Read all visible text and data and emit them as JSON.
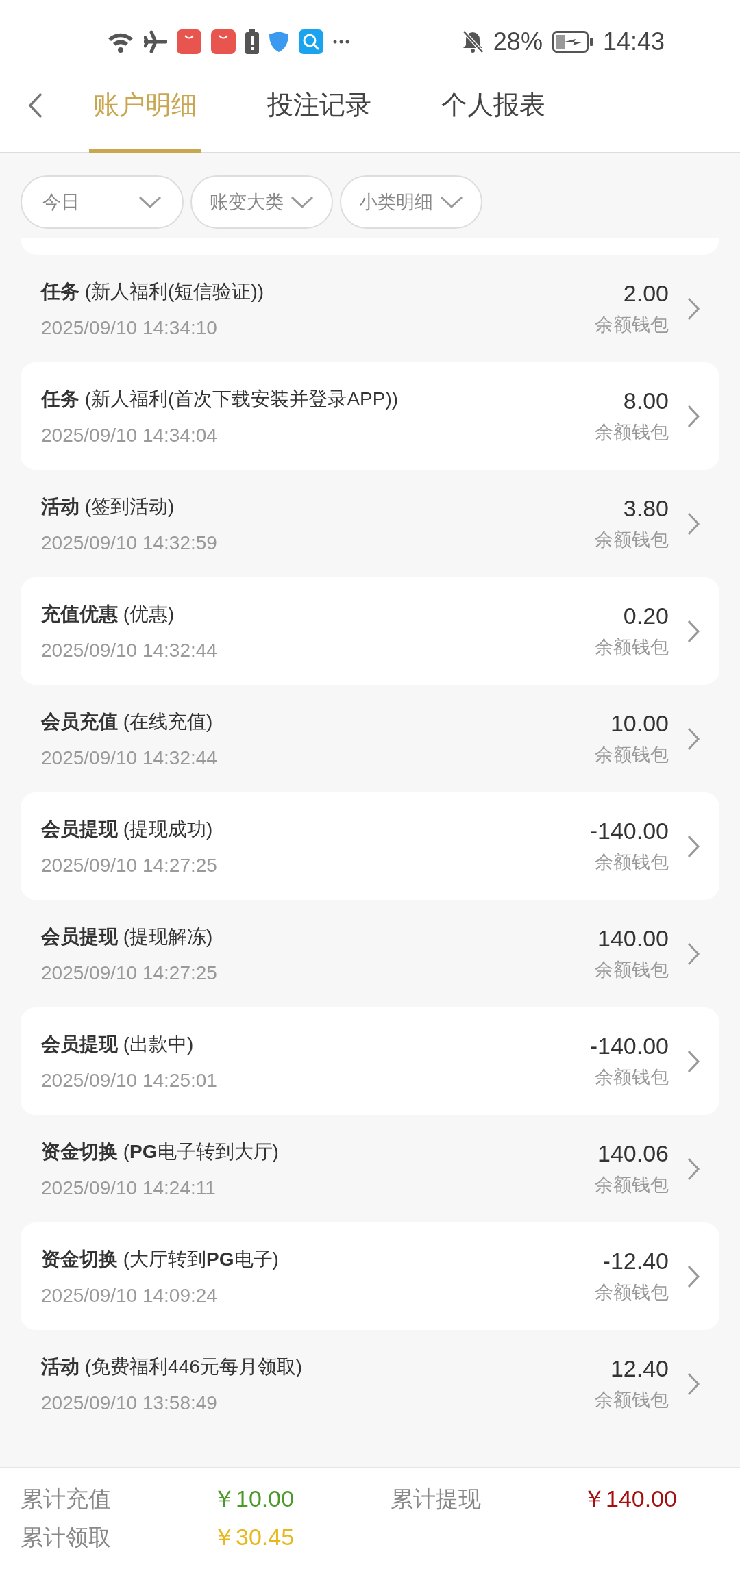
{
  "status_bar": {
    "battery": "28%",
    "time": "14:43"
  },
  "tabs": [
    {
      "label": "账户明细",
      "selected": true
    },
    {
      "label": "投注记录",
      "selected": false
    },
    {
      "label": "个人报表",
      "selected": false
    }
  ],
  "filters": [
    {
      "label": "今日"
    },
    {
      "label": "账变大类"
    },
    {
      "label": "小类明细"
    }
  ],
  "records": [
    {
      "title": "**任务** (新人福利(短信验证))",
      "time": "2025/09/10 14:34:10",
      "amount": "2.00",
      "wallet": "余额钱包"
    },
    {
      "title": "**任务** (新人福利(首次下载安装并登录APP))",
      "time": "2025/09/10 14:34:04",
      "amount": "8.00",
      "wallet": "余额钱包"
    },
    {
      "title": "**活动** (签到活动)",
      "time": "2025/09/10 14:32:59",
      "amount": "3.80",
      "wallet": "余额钱包"
    },
    {
      "title": "**充值优惠** (优惠)",
      "time": "2025/09/10 14:32:44",
      "amount": "0.20",
      "wallet": "余额钱包"
    },
    {
      "title": "**会员充值** (在线充值)",
      "time": "2025/09/10 14:32:44",
      "amount": "10.00",
      "wallet": "余额钱包"
    },
    {
      "title": "**会员提现** (提现成功)",
      "time": "2025/09/10 14:27:25",
      "amount": "-140.00",
      "wallet": "余额钱包"
    },
    {
      "title": "**会员提现** (提现解冻)",
      "time": "2025/09/10 14:27:25",
      "amount": "140.00",
      "wallet": "余额钱包"
    },
    {
      "title": "**会员提现** (出款中)",
      "time": "2025/09/10 14:25:01",
      "amount": "-140.00",
      "wallet": "余额钱包"
    },
    {
      "title": "**资金切换** (**PG**电子转到大厅)",
      "time": "2025/09/10 14:24:11",
      "amount": "140.06",
      "wallet": "余额钱包"
    },
    {
      "title": "**资金切换** (大厅转到**PG**电子)",
      "time": "2025/09/10 14:09:24",
      "amount": "-12.40",
      "wallet": "余额钱包"
    },
    {
      "title": "**活动** (免费福利446元每月领取)",
      "time": "2025/09/10 13:58:49",
      "amount": "12.40",
      "wallet": "余额钱包"
    }
  ],
  "totals": [
    {
      "label": "累计充值",
      "value": "￥10.00",
      "color": "#4a9a2a"
    },
    {
      "label": "累计提现",
      "value": "￥140.00",
      "color": "#a50f0f"
    },
    {
      "label": "累计领取",
      "value": "￥30.45",
      "color": "#e8b71a"
    }
  ]
}
